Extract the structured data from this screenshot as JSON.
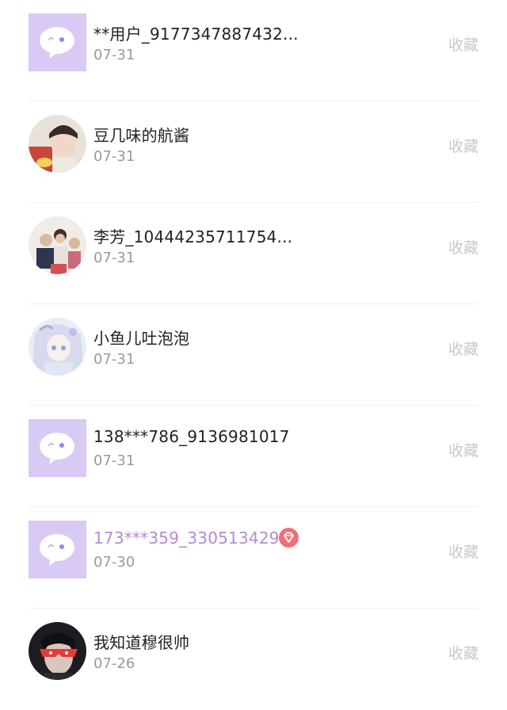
{
  "items": [
    {
      "name": "**用户_9177347887432...",
      "date": "07-31",
      "action": "收藏",
      "avatar": "default-chat-avatar",
      "vip": false
    },
    {
      "name": "豆几味的航酱",
      "date": "07-31",
      "action": "收藏",
      "avatar": "photo-avatar",
      "vip": false
    },
    {
      "name": "李芳_10444235711754...",
      "date": "07-31",
      "action": "收藏",
      "avatar": "group-photo-avatar",
      "vip": false
    },
    {
      "name": "小鱼儿吐泡泡",
      "date": "07-31",
      "action": "收藏",
      "avatar": "anime-avatar",
      "vip": false
    },
    {
      "name": "138***786_9136981017",
      "date": "07-31",
      "action": "收藏",
      "avatar": "default-chat-avatar",
      "vip": false
    },
    {
      "name": "173***359_3305134292",
      "date": "07-30",
      "action": "收藏",
      "avatar": "default-chat-avatar",
      "vip": true
    },
    {
      "name": "我知道穆很帅",
      "date": "07-26",
      "action": "收藏",
      "avatar": "red-mask-avatar",
      "vip": false
    }
  ],
  "colors": {
    "default_avatar_bg": "#d9c9f5",
    "vip_name": "#b58ad6",
    "vip_badge": "#f06e78",
    "action_text": "#c8c8c8"
  }
}
